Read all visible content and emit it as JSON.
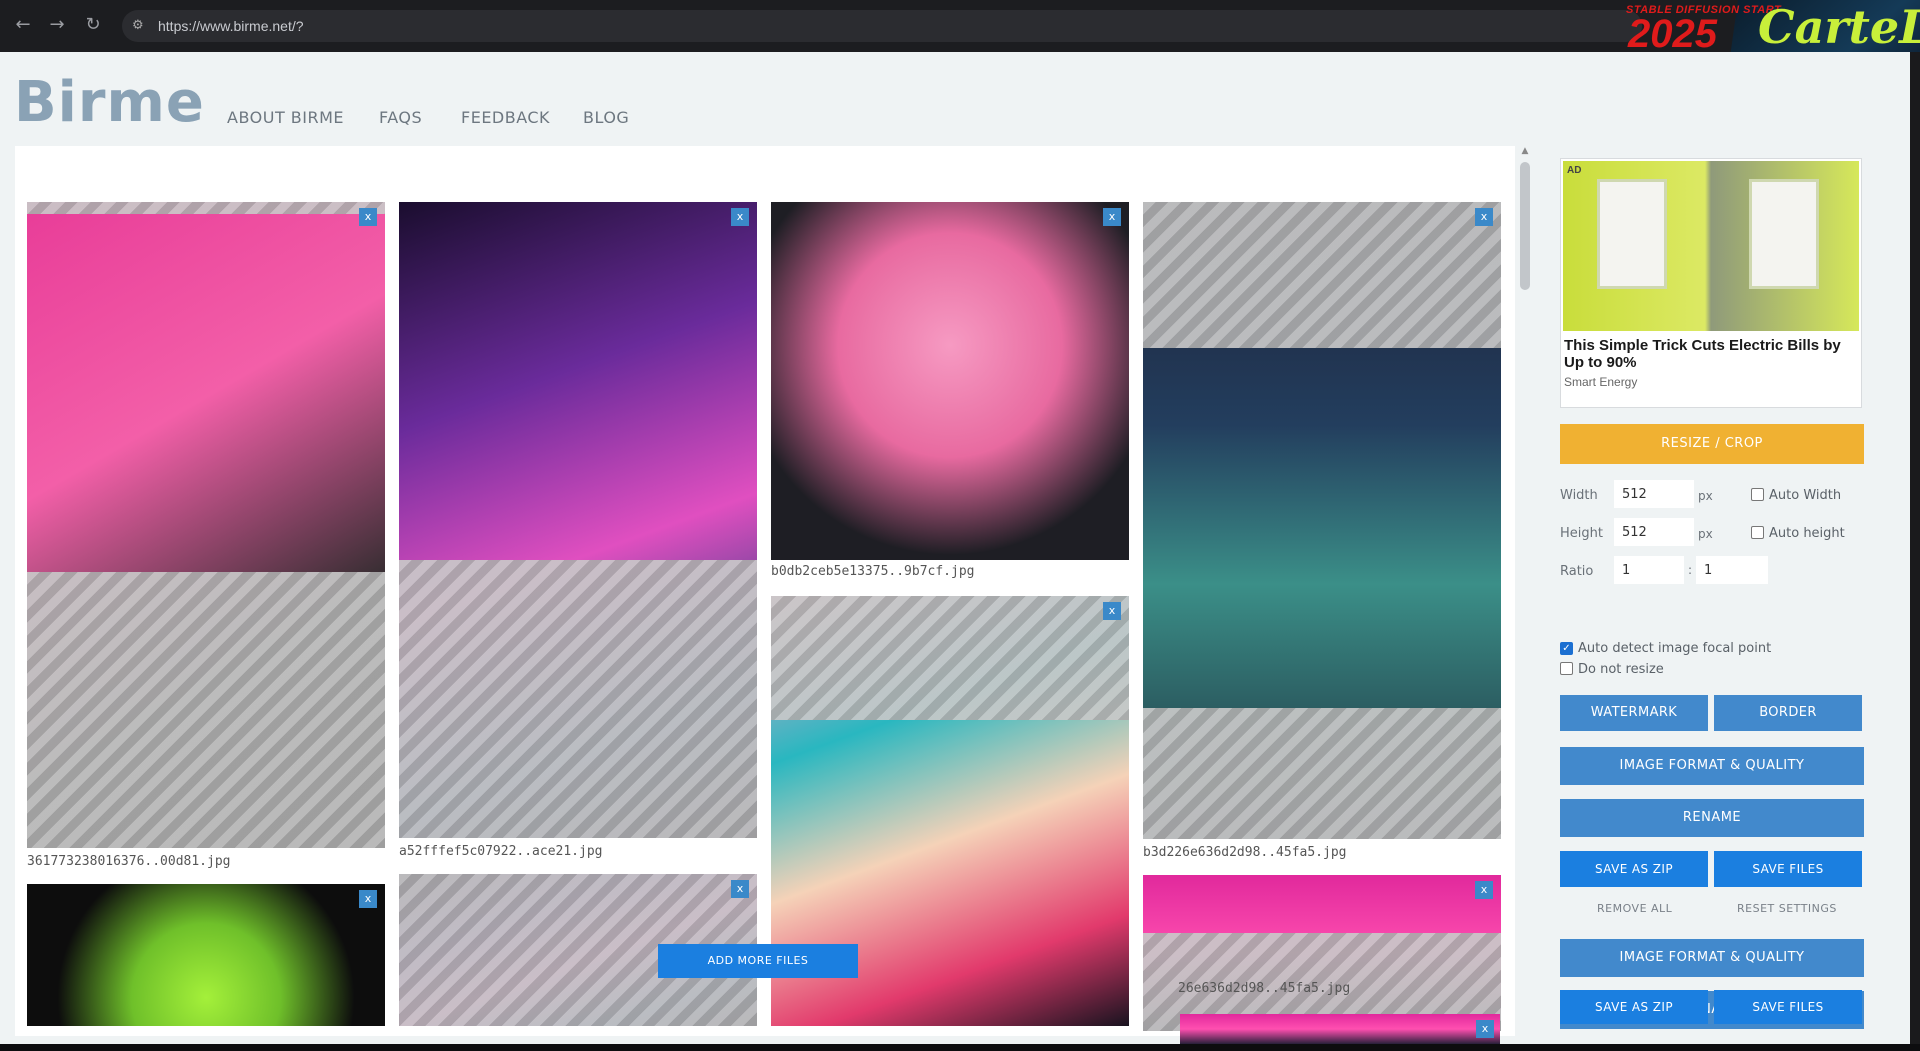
{
  "browser": {
    "back_icon": "arrow-left-icon",
    "forward_icon": "arrow-right-icon",
    "reload_icon": "reload-icon",
    "site_settings_icon": "tune-icon",
    "url": "https://www.birme.net/?",
    "overlay_small": "STABLE DIFFUSION START",
    "overlay_year": "2025",
    "overlay_tag": "CarteL"
  },
  "header": {
    "logo": "Birme",
    "nav": [
      "ABOUT BIRME",
      "FAQS",
      "FEEDBACK",
      "BLOG"
    ]
  },
  "gallery": {
    "close_label": "x",
    "filenames": [
      "361773238016376..00d81.jpg",
      "a52fffef5c07922..ace21.jpg",
      "b0db2ceb5e13375..9b7cf.jpg",
      "b3d226e636d2d98..45fa5.jpg",
      "26e636d2d98..45fa5.jpg"
    ],
    "add_more": "ADD MORE FILES"
  },
  "sidebar": {
    "ad": {
      "badge": "AD",
      "title": "This Simple Trick Cuts Electric Bills by Up to 90%",
      "source": "Smart Energy"
    },
    "resize_crop": "RESIZE / CROP",
    "width_label": "Width",
    "width_value": "512",
    "height_label": "Height",
    "height_value": "512",
    "unit": "px",
    "auto_width": "Auto Width",
    "auto_height": "Auto height",
    "ratio_label": "Ratio",
    "ratio_a": "1",
    "ratio_sep": ":",
    "ratio_b": "1",
    "auto_detect": "Auto detect image focal point",
    "auto_detect_checked": true,
    "do_not_resize": "Do not resize",
    "watermark": "WATERMARK",
    "border": "BORDER",
    "format_quality": "IMAGE FORMAT & QUALITY",
    "rename": "RENAME",
    "save_zip": "SAVE AS ZIP",
    "save_files": "SAVE FILES",
    "remove_all": "REMOVE ALL",
    "reset_settings": "RESET SETTINGS"
  },
  "colors": {
    "button_blue": "#4289cc",
    "button_bright_blue": "#1b7fe0",
    "resize_yellow": "#f0b132",
    "page_bg": "#eff3f4"
  }
}
